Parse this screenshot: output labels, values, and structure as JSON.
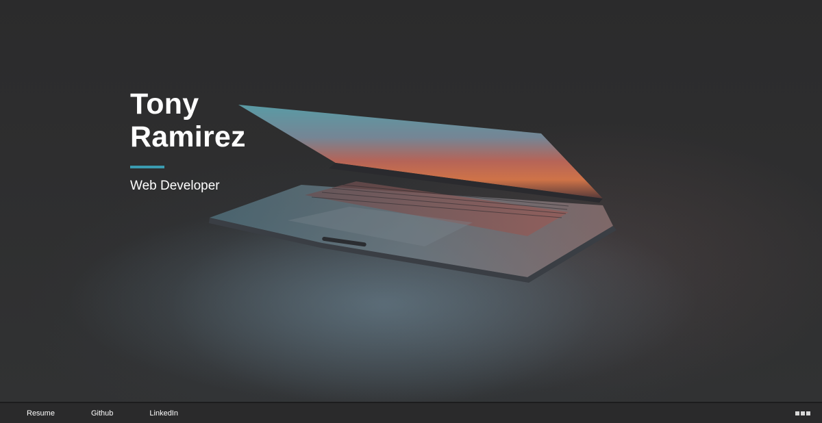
{
  "hero": {
    "name_line1": "Tony",
    "name_line2": "Ramirez",
    "role": "Web Developer",
    "accent_color": "#3a9bb0",
    "background_image": "laptop-image"
  },
  "footer": {
    "links": [
      {
        "label": "Resume"
      },
      {
        "label": "Github"
      },
      {
        "label": "LinkedIn"
      }
    ],
    "menu_icon": "menu-icon"
  }
}
